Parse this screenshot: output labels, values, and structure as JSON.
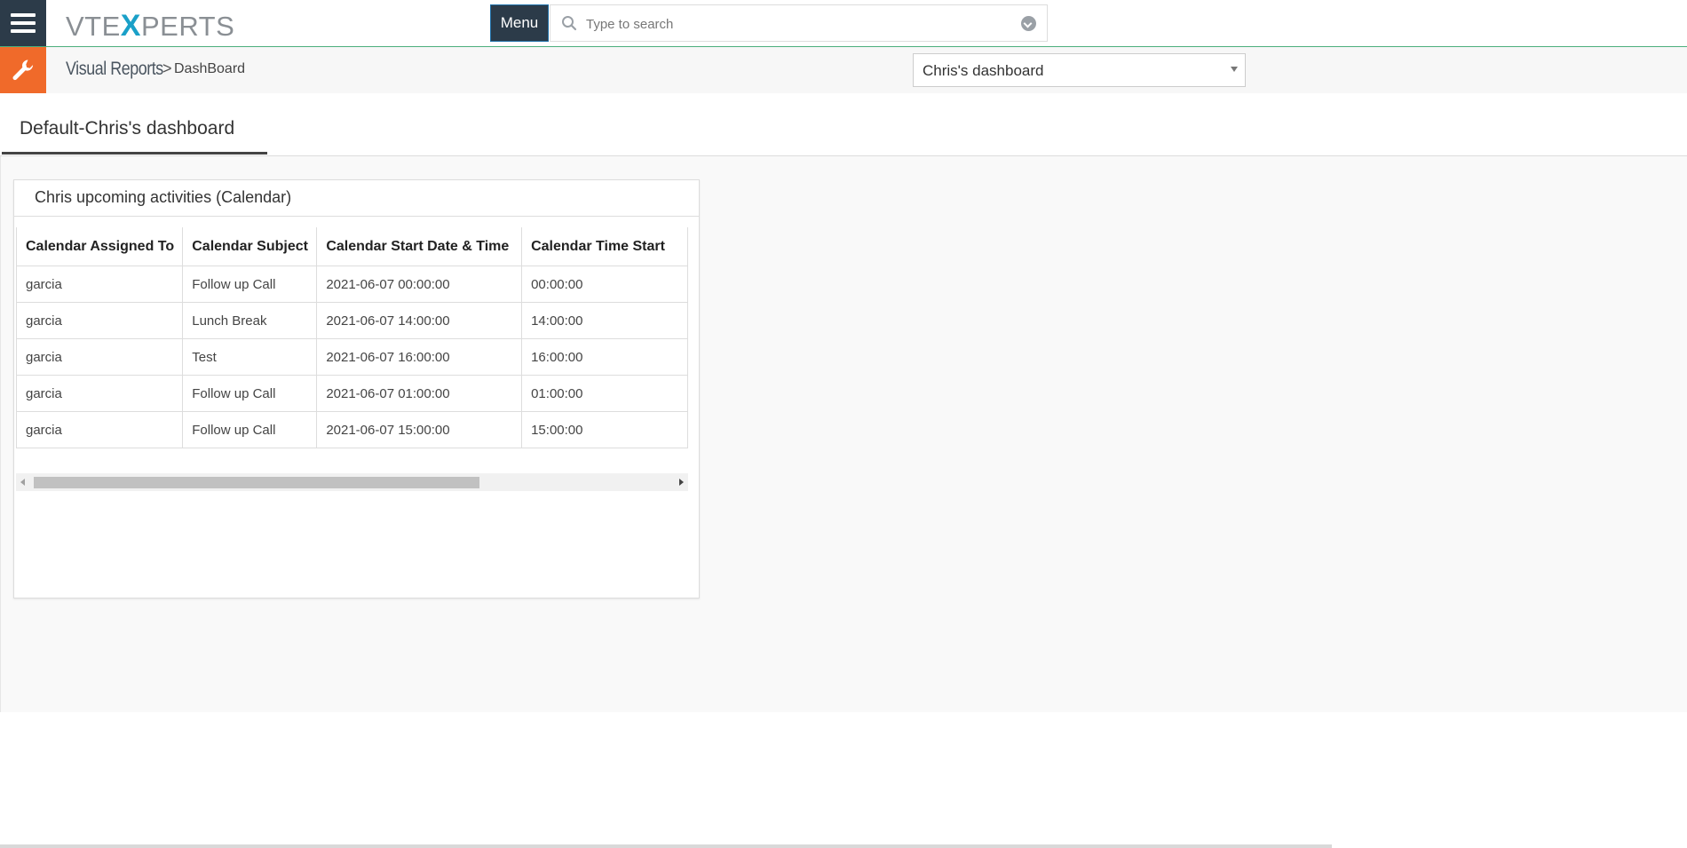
{
  "header": {
    "logo_prefix": "VTE",
    "logo_x": "X",
    "logo_suffix": "PERTS",
    "menu_label": "Menu",
    "search_placeholder": "Type to search"
  },
  "breadcrumb": {
    "module": "Visual Reports",
    "separator": ">",
    "page": "DashBoard"
  },
  "dashboard_select": {
    "value": "Chris's dashboard"
  },
  "tabs": [
    {
      "label": "Default-Chris's dashboard",
      "active": true
    }
  ],
  "widget": {
    "title": "Chris upcoming activities (Calendar)",
    "columns": [
      "Calendar Assigned To",
      "Calendar Subject",
      "Calendar Start Date & Time",
      "Calendar Time Start"
    ],
    "rows": [
      [
        "garcia",
        "Follow up Call",
        "2021-06-07 00:00:00",
        "00:00:00"
      ],
      [
        "garcia",
        "Lunch Break",
        "2021-06-07 14:00:00",
        "14:00:00"
      ],
      [
        "garcia",
        "Test",
        "2021-06-07 16:00:00",
        "16:00:00"
      ],
      [
        "garcia",
        "Follow up Call",
        "2021-06-07 01:00:00",
        "01:00:00"
      ],
      [
        "garcia",
        "Follow up Call",
        "2021-06-07 15:00:00",
        "15:00:00"
      ]
    ]
  },
  "colors": {
    "nav_dark": "#2c3b49",
    "accent_orange": "#f06a2a",
    "logo_x_blue": "#1aa0c8",
    "top_border_green": "#4caf7d"
  },
  "icons": {
    "hamburger": "hamburger-icon",
    "wrench": "wrench-icon",
    "search": "search-icon",
    "dropdown": "chevron-circle-down-icon"
  }
}
